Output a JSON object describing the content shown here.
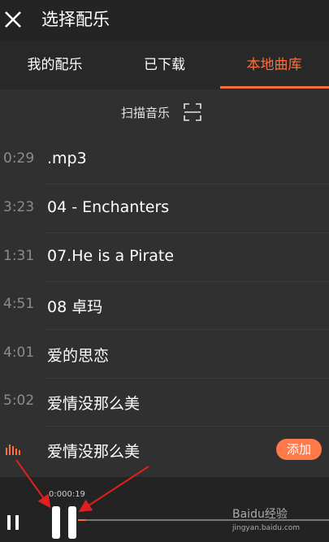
{
  "header": {
    "title": "选择配乐"
  },
  "tabs": [
    {
      "label": "我的配乐",
      "active": false
    },
    {
      "label": "已下载",
      "active": false
    },
    {
      "label": "本地曲库",
      "active": true
    }
  ],
  "scan": {
    "label": "扫描音乐"
  },
  "songs": [
    {
      "duration": "0:29",
      "title": ".mp3"
    },
    {
      "duration": "3:23",
      "title": "04 - Enchanters"
    },
    {
      "duration": "1:31",
      "title": "07.He is a Pirate"
    },
    {
      "duration": "4:51",
      "title": "08 卓玛"
    },
    {
      "duration": "4:01",
      "title": "爱的思恋"
    },
    {
      "duration": "5:02",
      "title": "爱情没那么美"
    },
    {
      "duration": "",
      "title": "爱情没那么美",
      "playing": true,
      "action": "添加"
    }
  ],
  "player": {
    "timecode": "0:000:19",
    "progress": 0.03
  },
  "watermark": {
    "brand": "Baidu经验",
    "url": "jingyan.baidu.com"
  },
  "colors": {
    "accent": "#ff6f3c",
    "background": "#303030"
  }
}
